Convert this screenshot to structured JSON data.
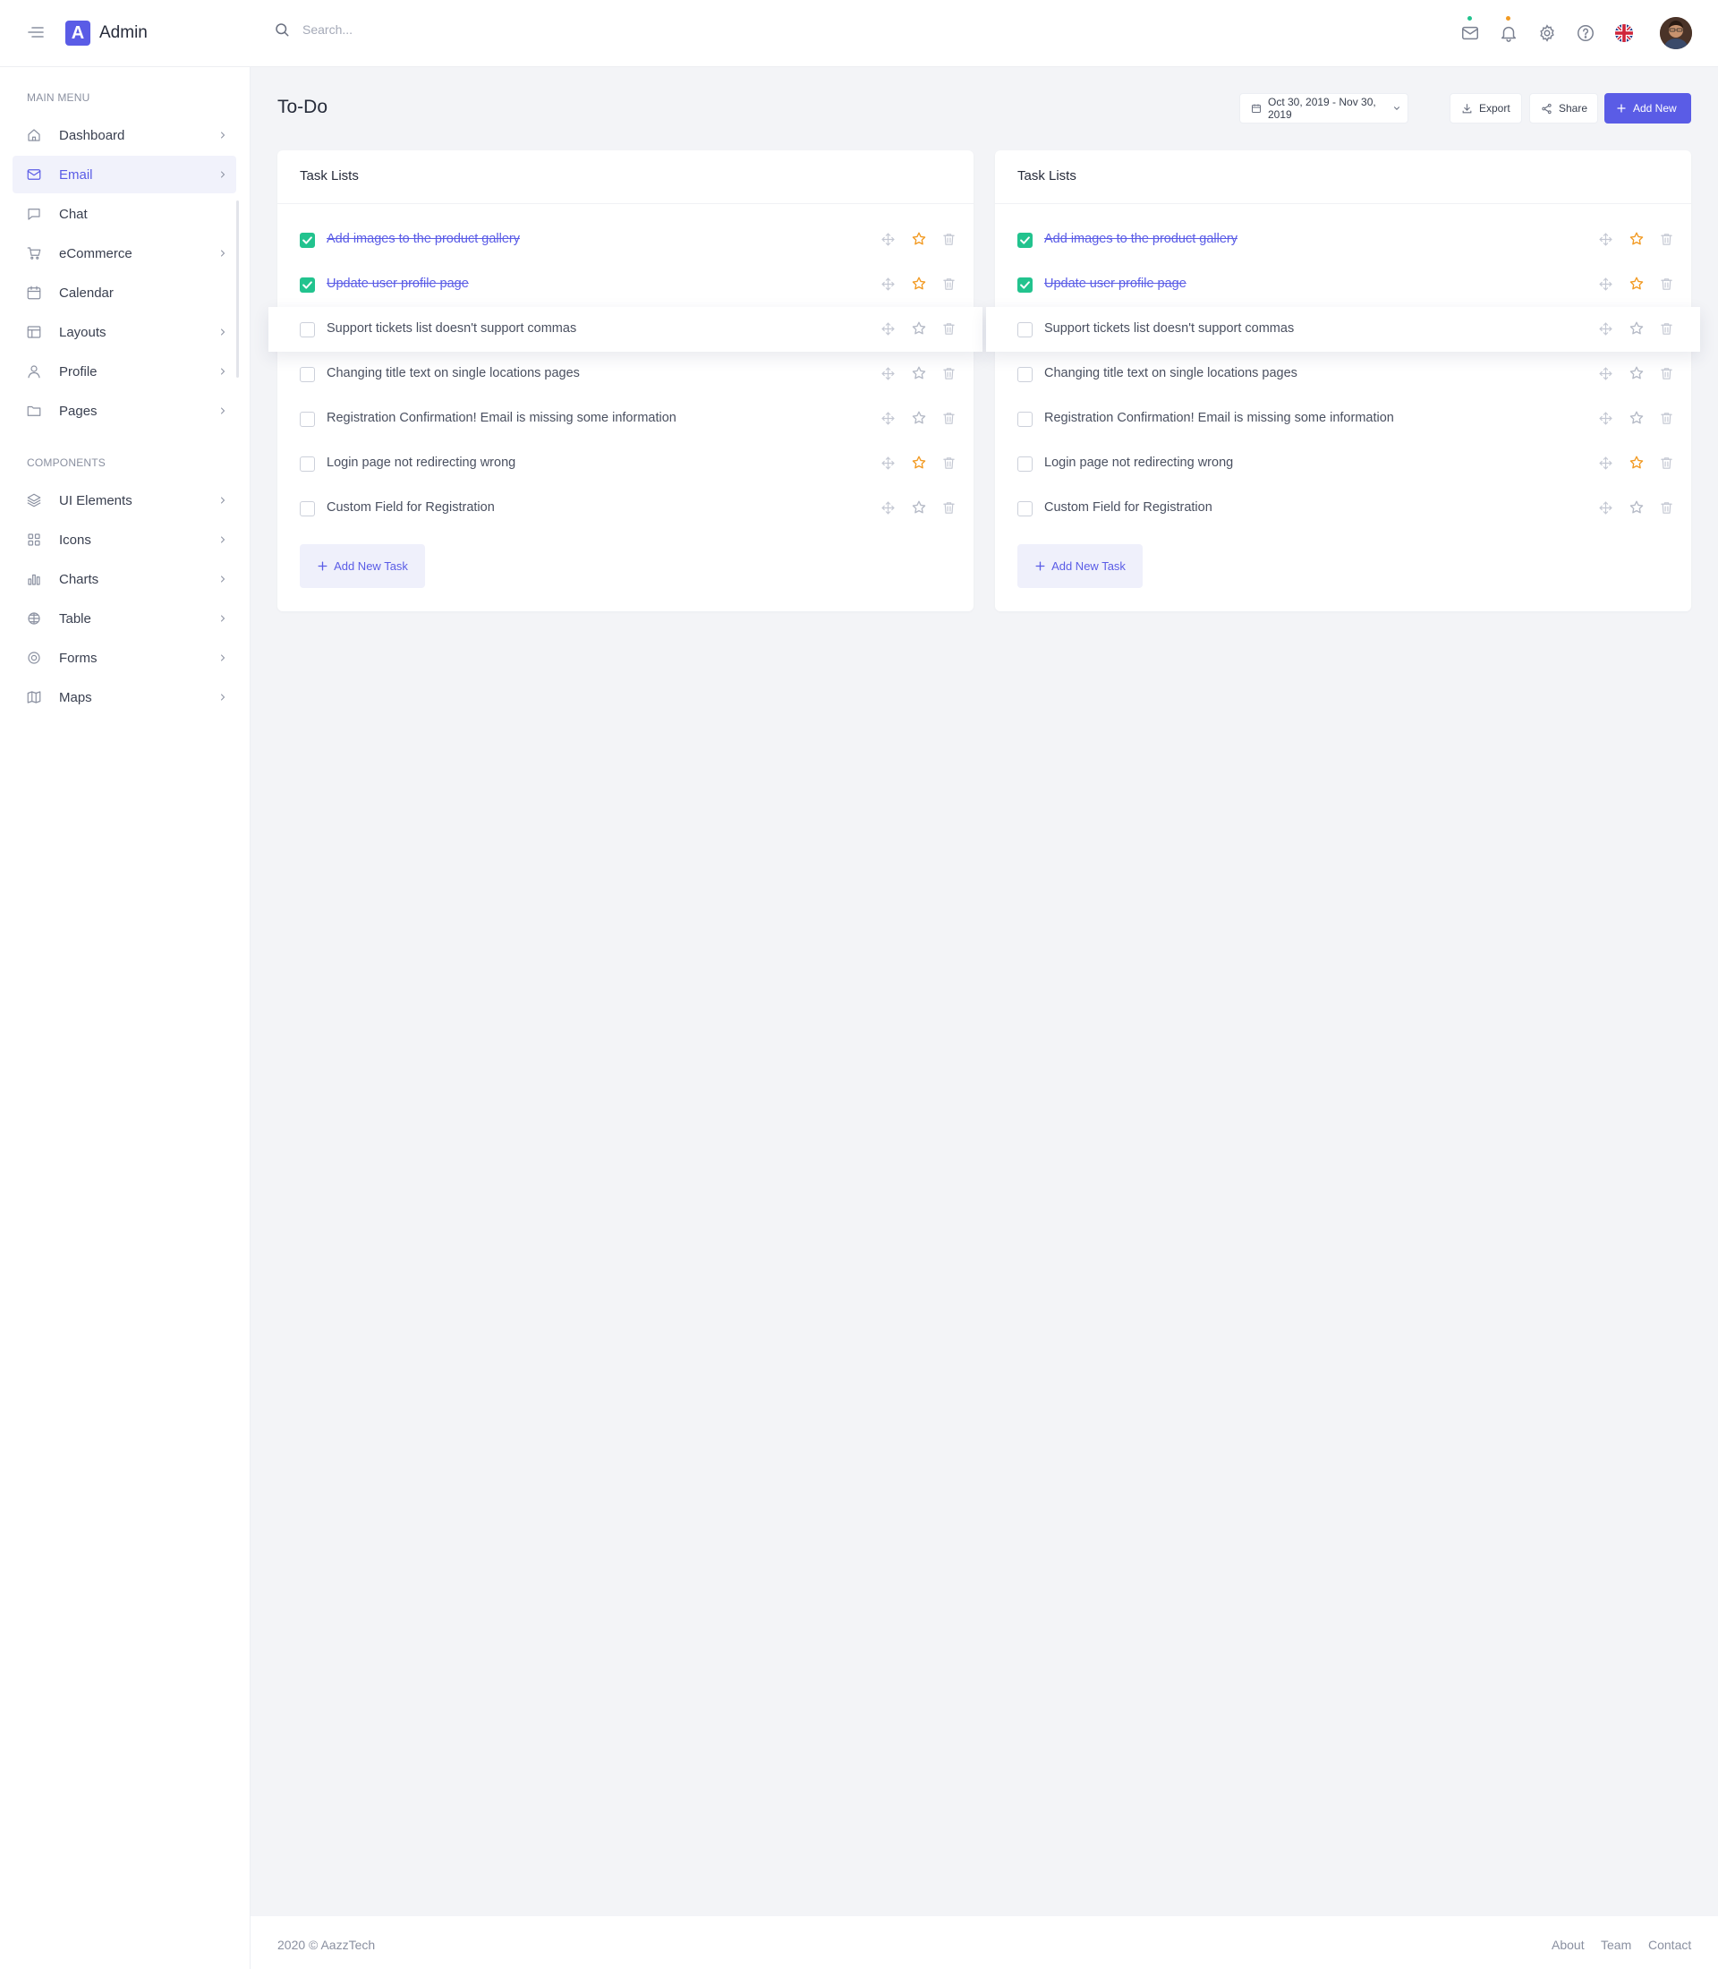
{
  "brand": {
    "logo_letter": "A",
    "name": "Admin",
    "accent": "#5a5ce6"
  },
  "search": {
    "placeholder": "Search..."
  },
  "topbar_icons": [
    "mail-icon",
    "bell-icon",
    "gear-icon",
    "help-icon",
    "uk-flag-icon"
  ],
  "sidebar": {
    "main_title": "MAIN MENU",
    "main_items": [
      {
        "label": "Dashboard",
        "icon": "home-icon",
        "has_chevron": true
      },
      {
        "label": "Email",
        "icon": "mail-icon",
        "has_chevron": true,
        "active": true
      },
      {
        "label": "Chat",
        "icon": "chat-icon",
        "has_chevron": false
      },
      {
        "label": "eCommerce",
        "icon": "cart-icon",
        "has_chevron": true
      },
      {
        "label": "Calendar",
        "icon": "calendar-icon",
        "has_chevron": false
      },
      {
        "label": "Layouts",
        "icon": "layout-icon",
        "has_chevron": true
      },
      {
        "label": "Profile",
        "icon": "user-icon",
        "has_chevron": true
      },
      {
        "label": "Pages",
        "icon": "folder-icon",
        "has_chevron": true
      }
    ],
    "components_title": "COMPONENTS",
    "component_items": [
      {
        "label": "UI Elements",
        "icon": "layers-icon",
        "has_chevron": true
      },
      {
        "label": "Icons",
        "icon": "grid-icon",
        "has_chevron": true
      },
      {
        "label": "Charts",
        "icon": "bar-chart-icon",
        "has_chevron": true
      },
      {
        "label": "Table",
        "icon": "table-icon",
        "has_chevron": true
      },
      {
        "label": "Forms",
        "icon": "target-icon",
        "has_chevron": true
      },
      {
        "label": "Maps",
        "icon": "map-icon",
        "has_chevron": true
      }
    ]
  },
  "header": {
    "title": "To-Do",
    "date_range": "Oct 30, 2019 - Nov 30, 2019",
    "export_label": "Export",
    "share_label": "Share",
    "add_new_label": "Add New"
  },
  "cards": [
    {
      "title": "Task Lists",
      "tasks": [
        {
          "text": "Add images to the product gallery",
          "done": true,
          "starred": true
        },
        {
          "text": "Update user profile page",
          "done": true,
          "starred": true
        },
        {
          "text": "Support tickets list doesn't support commas",
          "done": false,
          "starred": false
        },
        {
          "text": "Changing title text on single locations pages",
          "done": false,
          "starred": false
        },
        {
          "text": "Registration Confirmation! Email is missing some information",
          "done": false,
          "starred": false
        },
        {
          "text": "Login page not redirecting wrong",
          "done": false,
          "starred": true
        },
        {
          "text": "Custom Field for Registration",
          "done": false,
          "starred": false
        }
      ],
      "add_task_label": "Add New Task"
    },
    {
      "title": "Task Lists",
      "tasks": [
        {
          "text": "Add images to the product gallery",
          "done": true,
          "starred": true
        },
        {
          "text": "Update user profile page",
          "done": true,
          "starred": true
        },
        {
          "text": "Support tickets list doesn't support commas",
          "done": false,
          "starred": false
        },
        {
          "text": "Changing title text on single locations pages",
          "done": false,
          "starred": false
        },
        {
          "text": "Registration Confirmation! Email is missing some information",
          "done": false,
          "starred": false
        },
        {
          "text": "Login page not redirecting wrong",
          "done": false,
          "starred": true
        },
        {
          "text": "Custom Field for Registration",
          "done": false,
          "starred": false
        }
      ],
      "add_task_label": "Add New Task"
    }
  ],
  "footer": {
    "copyright": "2020 © AazzTech",
    "links": [
      "About",
      "Team",
      "Contact"
    ]
  },
  "colors": {
    "accent": "#5a5ce6",
    "checked": "#22c38e",
    "star": "#f29a22",
    "mail_dot": "#22c38e",
    "bell_dot": "#f29a22"
  }
}
